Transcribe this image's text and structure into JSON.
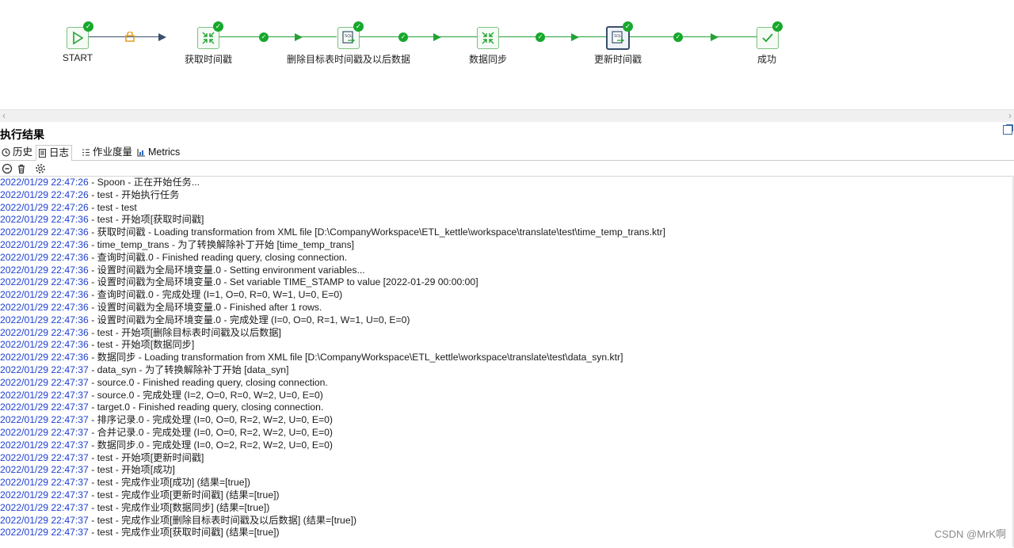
{
  "workflow": {
    "nodes": [
      {
        "label": "START",
        "icon": "play-icon"
      },
      {
        "label": "获取时间戳",
        "icon": "transformation-icon"
      },
      {
        "label": "删除目标表时间戳及以后数据",
        "icon": "sql-script-icon"
      },
      {
        "label": "数据同步",
        "icon": "transformation-icon"
      },
      {
        "label": "更新时间戳",
        "icon": "sql-script-icon"
      },
      {
        "label": "成功",
        "icon": "success-check-icon"
      }
    ],
    "status_mark": "✓"
  },
  "panel": {
    "title": "执行结果",
    "tabs": [
      {
        "label": "历史",
        "icon": "history-icon"
      },
      {
        "label": "日志",
        "icon": "log-icon"
      },
      {
        "label": "作业度量",
        "icon": "metrics-list-icon"
      },
      {
        "label": "Metrics",
        "icon": "chart-icon"
      }
    ],
    "toolbar": [
      "stop-icon",
      "trash-icon",
      "settings-icon"
    ]
  },
  "log": [
    {
      "ts": "2022/01/29 22:47:26",
      "msg": " - Spoon - 正在开始任务..."
    },
    {
      "ts": "2022/01/29 22:47:26",
      "msg": " - test - 开始执行任务"
    },
    {
      "ts": "2022/01/29 22:47:26",
      "msg": " - test - test"
    },
    {
      "ts": "2022/01/29 22:47:36",
      "msg": " - test - 开始项[获取时间戳]"
    },
    {
      "ts": "2022/01/29 22:47:36",
      "msg": " - 获取时间戳 - Loading transformation from XML file [D:\\CompanyWorkspace\\ETL_kettle\\workspace\\translate\\test\\time_temp_trans.ktr]"
    },
    {
      "ts": "2022/01/29 22:47:36",
      "msg": " - time_temp_trans - 为了转换解除补丁开始  [time_temp_trans]"
    },
    {
      "ts": "2022/01/29 22:47:36",
      "msg": " - 查询时间戳.0 - Finished reading query, closing connection."
    },
    {
      "ts": "2022/01/29 22:47:36",
      "msg": " - 设置时间戳为全局环境变量.0 - Setting environment variables..."
    },
    {
      "ts": "2022/01/29 22:47:36",
      "msg": " - 设置时间戳为全局环境变量.0 - Set variable TIME_STAMP to value [2022-01-29 00:00:00]"
    },
    {
      "ts": "2022/01/29 22:47:36",
      "msg": " - 查询时间戳.0 - 完成处理 (I=1, O=0, R=0, W=1, U=0, E=0)"
    },
    {
      "ts": "2022/01/29 22:47:36",
      "msg": " - 设置时间戳为全局环境变量.0 - Finished after 1 rows."
    },
    {
      "ts": "2022/01/29 22:47:36",
      "msg": " - 设置时间戳为全局环境变量.0 - 完成处理 (I=0, O=0, R=1, W=1, U=0, E=0)"
    },
    {
      "ts": "2022/01/29 22:47:36",
      "msg": " - test - 开始项[删除目标表时间戳及以后数据]"
    },
    {
      "ts": "2022/01/29 22:47:36",
      "msg": " - test - 开始项[数据同步]"
    },
    {
      "ts": "2022/01/29 22:47:36",
      "msg": " - 数据同步 - Loading transformation from XML file [D:\\CompanyWorkspace\\ETL_kettle\\workspace\\translate\\test\\data_syn.ktr]"
    },
    {
      "ts": "2022/01/29 22:47:37",
      "msg": " - data_syn - 为了转换解除补丁开始  [data_syn]"
    },
    {
      "ts": "2022/01/29 22:47:37",
      "msg": " - source.0 - Finished reading query, closing connection."
    },
    {
      "ts": "2022/01/29 22:47:37",
      "msg": " - source.0 - 完成处理 (I=2, O=0, R=0, W=2, U=0, E=0)"
    },
    {
      "ts": "2022/01/29 22:47:37",
      "msg": " - target.0 - Finished reading query, closing connection."
    },
    {
      "ts": "2022/01/29 22:47:37",
      "msg": " - 排序记录.0 - 完成处理 (I=0, O=0, R=2, W=2, U=0, E=0)"
    },
    {
      "ts": "2022/01/29 22:47:37",
      "msg": " - 合并记录.0 - 完成处理 (I=0, O=0, R=2, W=2, U=0, E=0)"
    },
    {
      "ts": "2022/01/29 22:47:37",
      "msg": " - 数据同步.0 - 完成处理 (I=0, O=2, R=2, W=2, U=0, E=0)"
    },
    {
      "ts": "2022/01/29 22:47:37",
      "msg": " - test - 开始项[更新时间戳]"
    },
    {
      "ts": "2022/01/29 22:47:37",
      "msg": " - test - 开始项[成功]"
    },
    {
      "ts": "2022/01/29 22:47:37",
      "msg": " - test - 完成作业项[成功] (结果=[true])"
    },
    {
      "ts": "2022/01/29 22:47:37",
      "msg": " - test - 完成作业项[更新时间戳] (结果=[true])"
    },
    {
      "ts": "2022/01/29 22:47:37",
      "msg": " - test - 完成作业项[数据同步] (结果=[true])"
    },
    {
      "ts": "2022/01/29 22:47:37",
      "msg": " - test - 完成作业项[删除目标表时间戳及以后数据] (结果=[true])"
    },
    {
      "ts": "2022/01/29 22:47:37",
      "msg": " - test - 完成作业项[获取时间戳] (结果=[true])"
    }
  ],
  "watermark": "CSDN @MrK啊",
  "colors": {
    "success": "#17a82b",
    "hop": "#25a236",
    "timestamp": "#1d3fd1"
  }
}
